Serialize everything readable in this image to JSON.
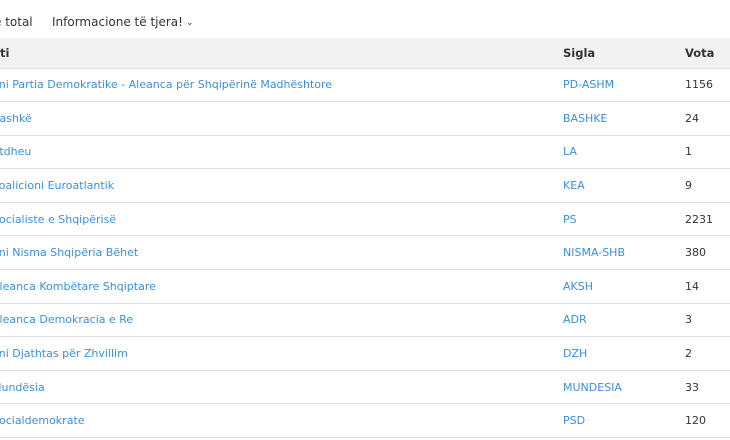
{
  "tabs": {
    "tab1_label": "ë total",
    "tab2_label": "Informacione të tjera!",
    "tab2_chevron": "⌄"
  },
  "table": {
    "headers": {
      "party": "ti",
      "sigla": "Sigla",
      "vota": "Vota"
    },
    "rows": [
      {
        "party": "oni Partia Demokratike - Aleanca për Shqipërinë Madhështore",
        "sigla": "PD-ASHM",
        "vota": "1156"
      },
      {
        "party": " Bashkë",
        "sigla": "BASHKE",
        "vota": "24"
      },
      {
        "party": " Atdheu",
        "sigla": "LA",
        "vota": "1"
      },
      {
        "party": "Koalicioni Euroatlantik",
        "sigla": "KEA",
        "vota": "9"
      },
      {
        "party": "Socialiste e Shqipërisë",
        "sigla": "PS",
        "vota": "2231"
      },
      {
        "party": "oni Nisma Shqipëria Bëhet",
        "sigla": "NISMA-SHB",
        "vota": "380"
      },
      {
        "party": "Aleanca Kombëtare Shqiptare",
        "sigla": "AKSH",
        "vota": "14"
      },
      {
        "party": "Aleanca Demokracia e Re",
        "sigla": "ADR",
        "vota": "3"
      },
      {
        "party": "oni Djathtas për Zhvillim",
        "sigla": "DZH",
        "vota": "2"
      },
      {
        "party": "Mundësia",
        "sigla": "MUNDESIA",
        "vota": "33"
      },
      {
        "party": "Socialdemokrate",
        "sigla": "PSD",
        "vota": "120"
      }
    ]
  },
  "colors": {
    "link": "#3d8fd6",
    "header_bg": "#f2f2f2"
  }
}
